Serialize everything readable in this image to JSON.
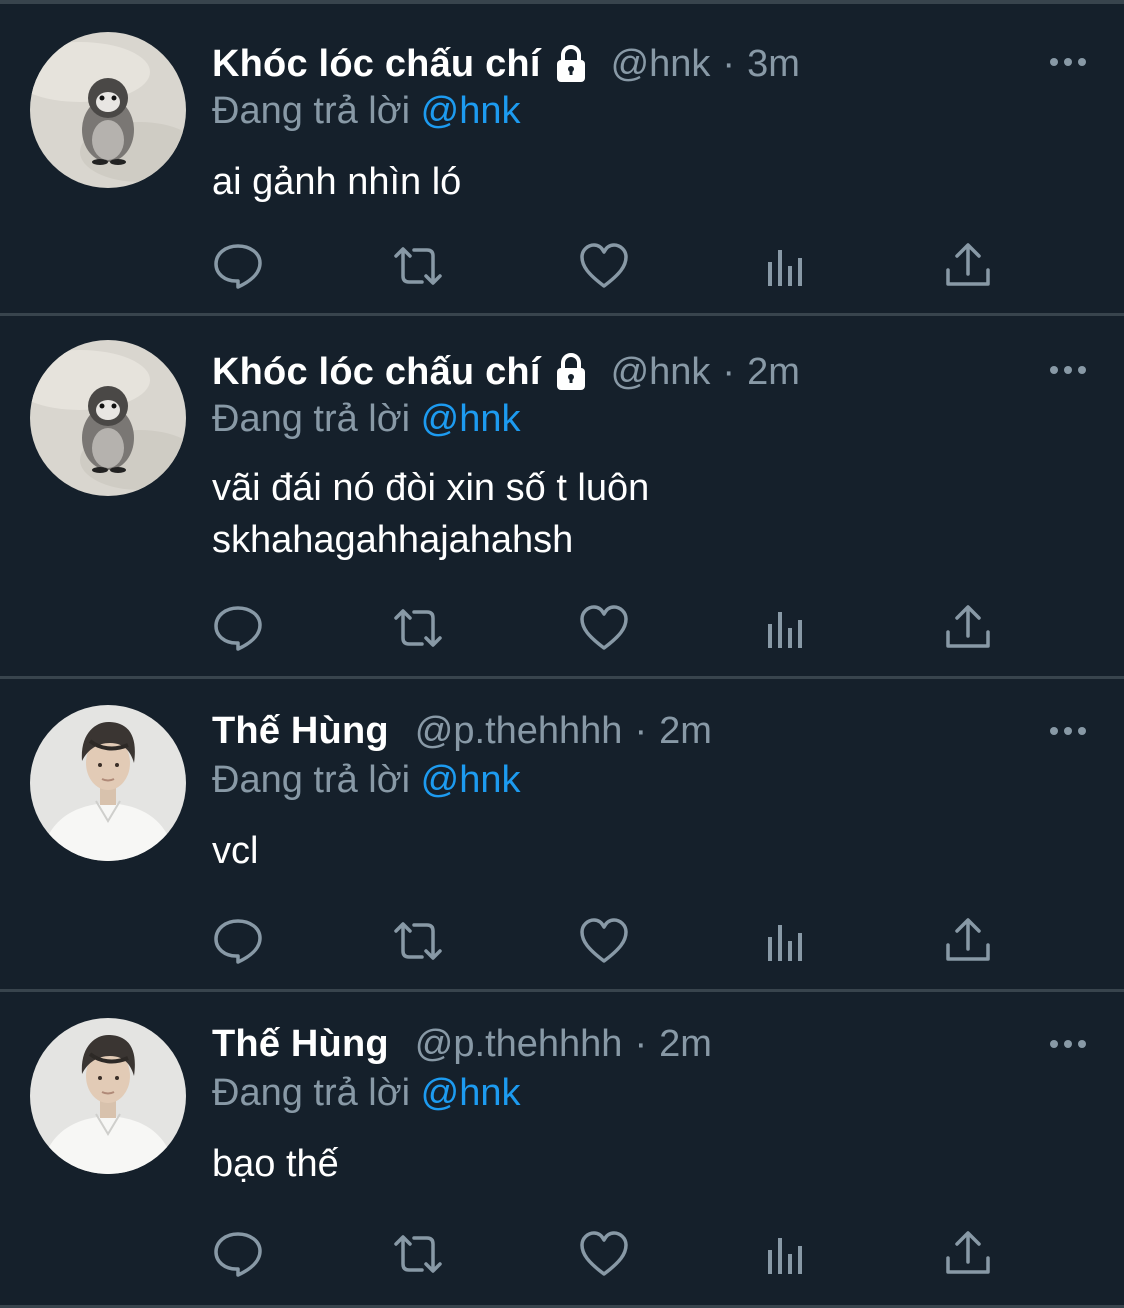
{
  "tweets": [
    {
      "display_name": "Khóc lóc chấu chí",
      "locked": true,
      "handle": "@hnk",
      "separator": "·",
      "time": "3m",
      "reply_prefix": "Đang trả lời",
      "reply_mention": "@hnk",
      "text": "ai gảnh nhìn ló",
      "avatar": "penguin-plush-avatar"
    },
    {
      "display_name": "Khóc lóc chấu chí",
      "locked": true,
      "handle": "@hnk",
      "separator": "·",
      "time": "2m",
      "reply_prefix": "Đang trả lời",
      "reply_mention": "@hnk",
      "text": "vãi đái nó đòi xin số t luôn\nskhahagahhajahahsh",
      "avatar": "penguin-plush-avatar"
    },
    {
      "display_name": "Thế Hùng",
      "locked": false,
      "handle": "@p.thehhhh",
      "separator": "·",
      "time": "2m",
      "reply_prefix": "Đang trả lời",
      "reply_mention": "@hnk",
      "text": "vcl",
      "avatar": "man-portrait-avatar"
    },
    {
      "display_name": "Thế Hùng",
      "locked": false,
      "handle": "@p.thehhhh",
      "separator": "·",
      "time": "2m",
      "reply_prefix": "Đang trả lời",
      "reply_mention": "@hnk",
      "text": "bạo thế",
      "avatar": "man-portrait-avatar"
    }
  ],
  "icons": {
    "reply": "reply-icon",
    "retweet": "retweet-icon",
    "like": "heart-icon",
    "analytics": "analytics-icon",
    "share": "share-icon",
    "more": "more-icon",
    "lock": "lock-icon"
  },
  "colors": {
    "background": "#15202b",
    "divider": "#38444d",
    "primary_text": "#ffffff",
    "secondary_text": "#8899a6",
    "mention": "#1d9bf0"
  }
}
